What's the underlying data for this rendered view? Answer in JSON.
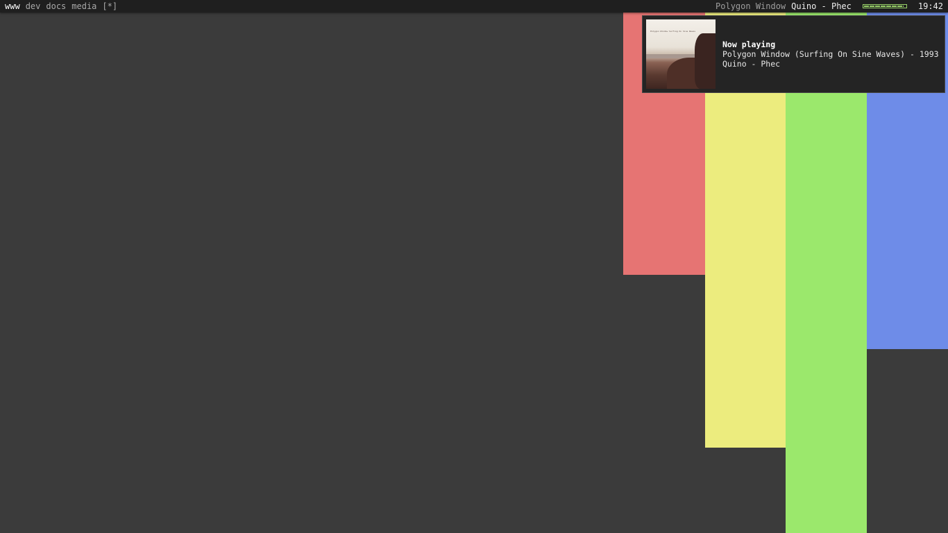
{
  "topbar": {
    "tags": [
      {
        "label": "www",
        "active": true
      },
      {
        "label": "dev",
        "active": false
      },
      {
        "label": "docs",
        "active": false
      },
      {
        "label": "media",
        "active": false
      },
      {
        "label": "[*]",
        "active": false
      }
    ],
    "now_playing_album": "Polygon Window",
    "now_playing_track": "Quino - Phec",
    "volume_fraction": 0.95,
    "clock": "19:42"
  },
  "notification": {
    "title": "Now playing",
    "line1": "Polygon Window (Surfing On Sine Waves) - 1993",
    "line2": "Quino - Phec",
    "cover_icon": "album-cover-image",
    "cover_text": "Polygon Window Surfing On Sine Waves"
  },
  "colors": {
    "background": "#3b3b3b",
    "topbar": "#1f1f1f",
    "red": "#e67473",
    "yellow": "#ecec7e",
    "green": "#9be86c",
    "blue": "#6e8ce8",
    "volume": "#9ad46a"
  }
}
